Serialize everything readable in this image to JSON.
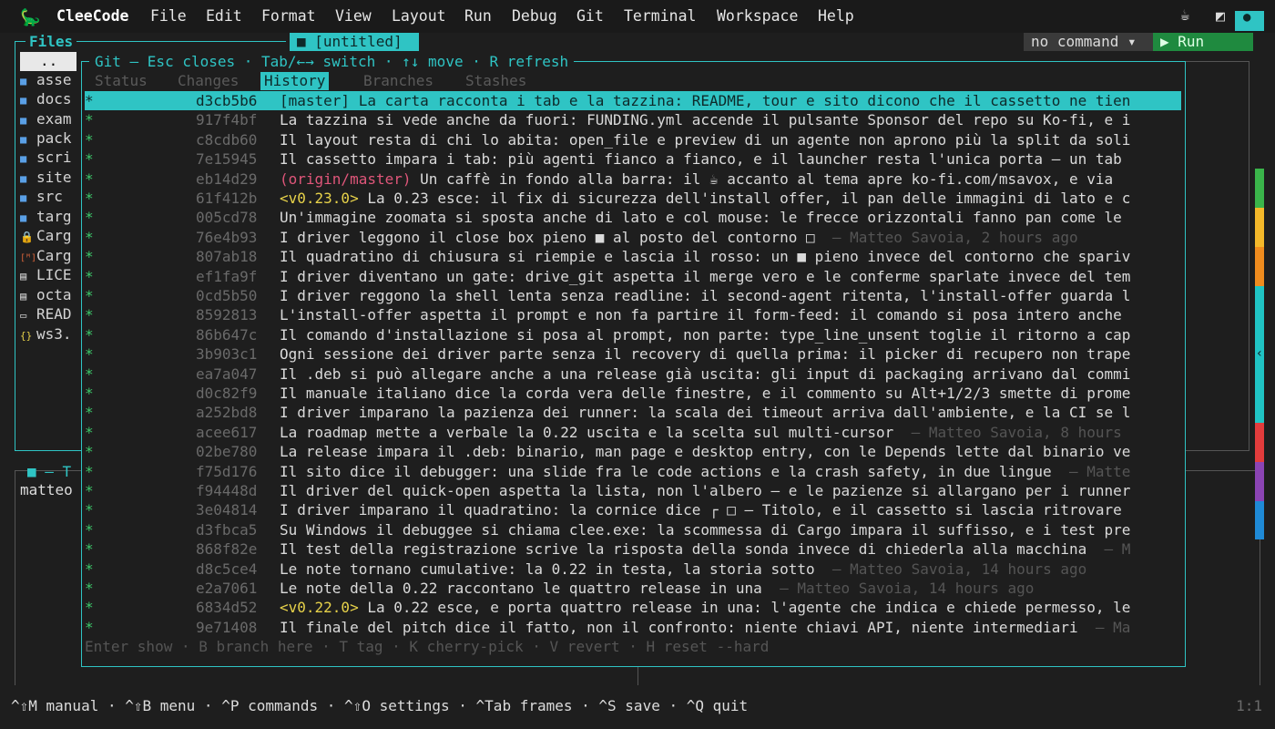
{
  "menubar": {
    "logo_glyph": "🦕",
    "app_title": "CleeCode",
    "items": [
      {
        "label": "File"
      },
      {
        "label": "Edit"
      },
      {
        "label": "Format"
      },
      {
        "label": "View"
      },
      {
        "label": "Layout"
      },
      {
        "label": "Run"
      },
      {
        "label": "Debug"
      },
      {
        "label": "Git"
      },
      {
        "label": "Terminal"
      },
      {
        "label": "Workspace"
      },
      {
        "label": "Help"
      }
    ],
    "coffee_glyph": "☕",
    "theme_glyph": "◩",
    "dot_glyph": "●"
  },
  "files": {
    "title": "Files",
    "items": [
      {
        "icon": "parent-dir",
        "glyph": "",
        "label": ".."
      },
      {
        "icon": "folder-icon",
        "glyph": "■",
        "label": "asse"
      },
      {
        "icon": "folder-icon",
        "glyph": "■",
        "label": "docs"
      },
      {
        "icon": "folder-icon",
        "glyph": "■",
        "label": "exam"
      },
      {
        "icon": "folder-icon",
        "glyph": "■",
        "label": "pack"
      },
      {
        "icon": "folder-icon",
        "glyph": "■",
        "label": "scri"
      },
      {
        "icon": "folder-icon",
        "glyph": "■",
        "label": "site"
      },
      {
        "icon": "folder-icon",
        "glyph": "■",
        "label": "src"
      },
      {
        "icon": "folder-icon",
        "glyph": "■",
        "label": "targ"
      },
      {
        "icon": "lock-icon",
        "glyph": "🔒",
        "label": "Carg"
      },
      {
        "icon": "cargo-file-icon",
        "glyph": "[ᴹ]",
        "label": "Carg"
      },
      {
        "icon": "file-icon",
        "glyph": "▤",
        "label": "LICE"
      },
      {
        "icon": "file-icon",
        "glyph": "▤",
        "label": "octa"
      },
      {
        "icon": "markdown-icon",
        "glyph": "▭",
        "label": "READ"
      },
      {
        "icon": "json-icon",
        "glyph": "{}",
        "label": "ws3."
      }
    ]
  },
  "editor": {
    "tab_label": "■ [untitled]",
    "command_select": "no command ▾",
    "run_label": "▶ Run"
  },
  "scrollbar": {
    "colors": [
      "#3ab44a",
      "#f4b82a",
      "#f08c1e",
      "#20c4c4",
      "#e23c3c",
      "#8b44b4",
      "#1f8ad6"
    ],
    "arrow": "‹"
  },
  "git": {
    "title": "Git — Esc closes · Tab/←→ switch · ↑↓ move · R refresh",
    "tabs": [
      "Status",
      "Changes",
      "History",
      "Branches",
      "Stashes"
    ],
    "active_tab": "History",
    "commits": [
      {
        "hash": "d3cb5b6",
        "ref": "[master] ",
        "ref_type": "head",
        "msg": "La carta racconta i tab e la tazzina: README, tour e sito dicono che il cassetto ne tien",
        "meta": ""
      },
      {
        "hash": "917f4bf",
        "ref": "",
        "ref_type": "",
        "msg": "La tazzina si vede anche da fuori: FUNDING.yml accende il pulsante Sponsor del repo su Ko-fi, e i",
        "meta": ""
      },
      {
        "hash": "c8cdb60",
        "ref": "",
        "ref_type": "",
        "msg": "Il layout resta di chi lo abita: open_file e preview di un agente non aprono più la split da soli",
        "meta": ""
      },
      {
        "hash": "7e15945",
        "ref": "",
        "ref_type": "",
        "msg": "Il cassetto impara i tab: più agenti fianco a fianco, e il launcher resta l'unica porta — un tab",
        "meta": ""
      },
      {
        "hash": "eb14d29",
        "ref": "(origin/master) ",
        "ref_type": "remote",
        "msg": "Un caffè in fondo alla barra: il ☕ accanto al tema apre ko-fi.com/msavox, e via",
        "meta": ""
      },
      {
        "hash": "61f412b",
        "ref": "<v0.23.0> ",
        "ref_type": "tag",
        "msg": "La 0.23 esce: il fix di sicurezza dell'install offer, il pan delle immagini di lato e c",
        "meta": ""
      },
      {
        "hash": "005cd78",
        "ref": "",
        "ref_type": "",
        "msg": "Un'immagine zoomata si sposta anche di lato e col mouse: le frecce orizzontali fanno pan come le",
        "meta": ""
      },
      {
        "hash": "76e4b93",
        "ref": "",
        "ref_type": "",
        "msg": "I driver leggono il close box pieno ■ al posto del contorno □",
        "meta": "  — Matteo Savoia, 2 hours ago"
      },
      {
        "hash": "807ab18",
        "ref": "",
        "ref_type": "",
        "msg": "Il quadratino di chiusura si riempie e lascia il rosso: un ■ pieno invece del contorno che spariv",
        "meta": ""
      },
      {
        "hash": "ef1fa9f",
        "ref": "",
        "ref_type": "",
        "msg": "I driver diventano un gate: drive_git aspetta il merge vero e le conferme sparlate invece del tem",
        "meta": ""
      },
      {
        "hash": "0cd5b50",
        "ref": "",
        "ref_type": "",
        "msg": "I driver reggono la shell lenta senza readline: il second-agent ritenta, l'install-offer guarda l",
        "meta": ""
      },
      {
        "hash": "8592813",
        "ref": "",
        "ref_type": "",
        "msg": "L'install-offer aspetta il prompt e non fa partire il form-feed: il comando si posa intero anche",
        "meta": ""
      },
      {
        "hash": "86b647c",
        "ref": "",
        "ref_type": "",
        "msg": "Il comando d'installazione si posa al prompt, non parte: type_line_unsent toglie il ritorno a cap",
        "meta": ""
      },
      {
        "hash": "3b903c1",
        "ref": "",
        "ref_type": "",
        "msg": "Ogni sessione dei driver parte senza il recovery di quella prima: il picker di recupero non trape",
        "meta": ""
      },
      {
        "hash": "ea7a047",
        "ref": "",
        "ref_type": "",
        "msg": "Il .deb si può allegare anche a una release già uscita: gli input di packaging arrivano dal commi",
        "meta": ""
      },
      {
        "hash": "d0c82f9",
        "ref": "",
        "ref_type": "",
        "msg": "Il manuale italiano dice la corda vera delle finestre, e il commento su Alt+1/2/3 smette di prome",
        "meta": ""
      },
      {
        "hash": "a252bd8",
        "ref": "",
        "ref_type": "",
        "msg": "I driver imparano la pazienza dei runner: la scala dei timeout arriva dall'ambiente, e la CI se l",
        "meta": ""
      },
      {
        "hash": "acee617",
        "ref": "",
        "ref_type": "",
        "msg": "La roadmap mette a verbale la 0.22 uscita e la scelta sul multi-cursor",
        "meta": "  — Matteo Savoia, 8 hours"
      },
      {
        "hash": "02be780",
        "ref": "",
        "ref_type": "",
        "msg": "La release impara il .deb: binario, man page e desktop entry, con le Depends lette dal binario ve",
        "meta": ""
      },
      {
        "hash": "f75d176",
        "ref": "",
        "ref_type": "",
        "msg": "Il sito dice il debugger: una slide fra le code actions e la crash safety, in due lingue",
        "meta": "  — Matte"
      },
      {
        "hash": "f94448d",
        "ref": "",
        "ref_type": "",
        "msg": "Il driver del quick-open aspetta la lista, non l'albero — e le pazienze si allargano per i runner",
        "meta": ""
      },
      {
        "hash": "3e04814",
        "ref": "",
        "ref_type": "",
        "msg": "I driver imparano il quadratino: la cornice dice ┌ □ — Titolo, e il cassetto si lascia ritrovare",
        "meta": ""
      },
      {
        "hash": "d3fbca5",
        "ref": "",
        "ref_type": "",
        "msg": "Su Windows il debuggee si chiama clee.exe: la scommessa di Cargo impara il suffisso, e i test pre",
        "meta": ""
      },
      {
        "hash": "868f82e",
        "ref": "",
        "ref_type": "",
        "msg": "Il test della registrazione scrive la risposta della sonda invece di chiederla alla macchina",
        "meta": "  — M"
      },
      {
        "hash": "d8c5ce4",
        "ref": "",
        "ref_type": "",
        "msg": "Le note tornano cumulative: la 0.22 in testa, la storia sotto",
        "meta": "  — Matteo Savoia, 14 hours ago"
      },
      {
        "hash": "e2a7061",
        "ref": "",
        "ref_type": "",
        "msg": "Le note della 0.22 raccontano le quattro release in una",
        "meta": "  — Matteo Savoia, 14 hours ago"
      },
      {
        "hash": "6834d52",
        "ref": "<v0.22.0> ",
        "ref_type": "tag",
        "msg": "La 0.22 esce, e porta quattro release in una: l'agente che indica e chiede permesso, le",
        "meta": ""
      },
      {
        "hash": "9e71408",
        "ref": "",
        "ref_type": "",
        "msg": "Il finale del pitch dice il fatto, non il confronto: niente chiavi API, niente intermediari",
        "meta": "  — Ma"
      }
    ],
    "hint": "Enter show · B branch here · T tag · K cherry-pick · V revert · H reset --hard"
  },
  "lower_left": {
    "header": "■ — T",
    "user": "matteo"
  },
  "statusbar": {
    "shortcuts": "^⇧M manual · ^⇧B menu · ^P commands · ^⇧O settings · ^Tab frames · ^S save · ^Q quit",
    "cursor": "1:1"
  },
  "colors": {
    "accent": "#2fc4c4",
    "run_green": "#1f8a3f",
    "star_green": "#3cc86a",
    "tag_yellow": "#e7d24a",
    "remote_pink": "#e0567a"
  }
}
